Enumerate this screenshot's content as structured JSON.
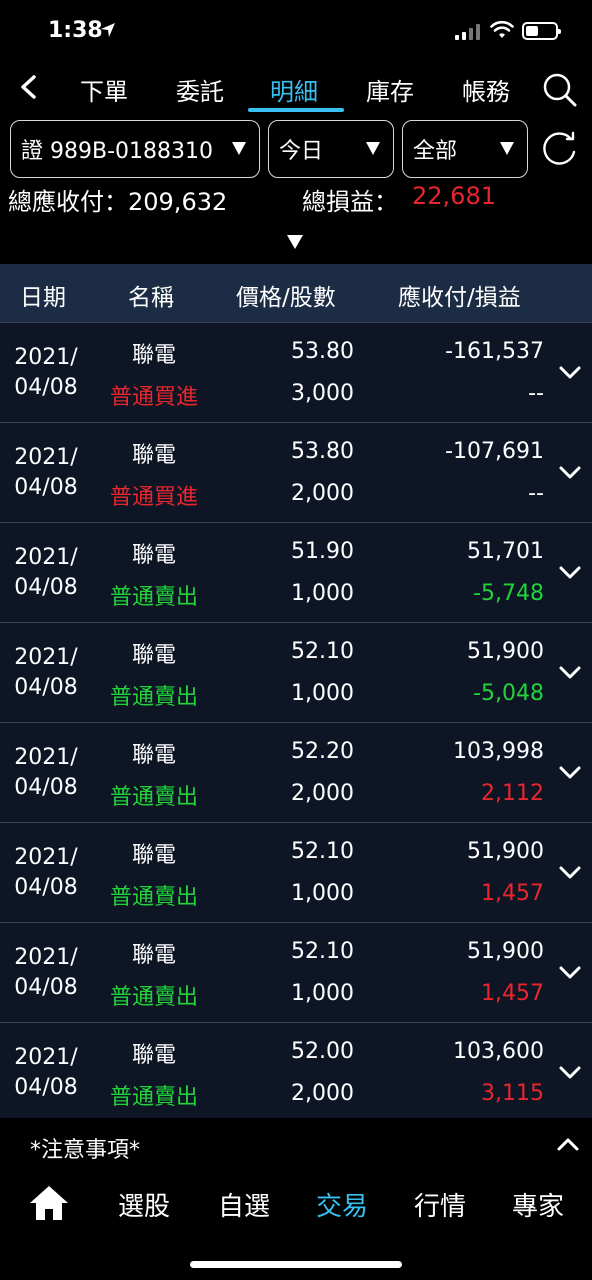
{
  "status": {
    "time": "1:38"
  },
  "nav": {
    "tabs": [
      {
        "label": "下單"
      },
      {
        "label": "委託"
      },
      {
        "label": "明細"
      },
      {
        "label": "庫存"
      },
      {
        "label": "帳務"
      }
    ],
    "active": "明細"
  },
  "filters": {
    "account": "證 989B-0188310",
    "date": "今日",
    "scope": "全部"
  },
  "summary": {
    "payable_label": "總應收付：",
    "payable_value": "209,632",
    "pnl_label": "總損益：",
    "pnl_value": "22,681"
  },
  "table": {
    "headers": [
      "日期",
      "名稱",
      "價格/股數",
      "應收付/損益"
    ],
    "rows": [
      {
        "date_y": "2021/",
        "date_md": "04/08",
        "name": "聯電",
        "type": "普通買進",
        "price": "53.80",
        "qty": "3,000",
        "amount": "-161,537",
        "pnl": "--"
      },
      {
        "date_y": "2021/",
        "date_md": "04/08",
        "name": "聯電",
        "type": "普通買進",
        "price": "53.80",
        "qty": "2,000",
        "amount": "-107,691",
        "pnl": "--"
      },
      {
        "date_y": "2021/",
        "date_md": "04/08",
        "name": "聯電",
        "type": "普通賣出",
        "price": "51.90",
        "qty": "1,000",
        "amount": "51,701",
        "pnl": "-5,748"
      },
      {
        "date_y": "2021/",
        "date_md": "04/08",
        "name": "聯電",
        "type": "普通賣出",
        "price": "52.10",
        "qty": "1,000",
        "amount": "51,900",
        "pnl": "-5,048"
      },
      {
        "date_y": "2021/",
        "date_md": "04/08",
        "name": "聯電",
        "type": "普通賣出",
        "price": "52.20",
        "qty": "2,000",
        "amount": "103,998",
        "pnl": "2,112"
      },
      {
        "date_y": "2021/",
        "date_md": "04/08",
        "name": "聯電",
        "type": "普通賣出",
        "price": "52.10",
        "qty": "1,000",
        "amount": "51,900",
        "pnl": "1,457"
      },
      {
        "date_y": "2021/",
        "date_md": "04/08",
        "name": "聯電",
        "type": "普通賣出",
        "price": "52.10",
        "qty": "1,000",
        "amount": "51,900",
        "pnl": "1,457"
      },
      {
        "date_y": "2021/",
        "date_md": "04/08",
        "name": "聯電",
        "type": "普通賣出",
        "price": "52.00",
        "qty": "2,000",
        "amount": "103,600",
        "pnl": "3,115"
      }
    ]
  },
  "notice": {
    "label": "*注意事項*"
  },
  "bottom_nav": {
    "items": [
      {
        "label": "選股"
      },
      {
        "label": "自選"
      },
      {
        "label": "交易"
      },
      {
        "label": "行情"
      },
      {
        "label": "專家"
      }
    ],
    "active": "交易"
  },
  "colors": {
    "accent": "#38c0f0",
    "buy_red": "#e8262d",
    "sell_green": "#23d33a",
    "header_bg": "#1b2c44",
    "row_bg": "#0e1626"
  },
  "icons": [
    "location-arrow-icon",
    "signal-icon",
    "wifi-icon",
    "battery-icon",
    "back-icon",
    "search-icon",
    "dropdown-triangle-icon",
    "refresh-icon",
    "expand-triangle-icon",
    "chevron-down-icon",
    "chevron-up-icon",
    "home-icon"
  ]
}
